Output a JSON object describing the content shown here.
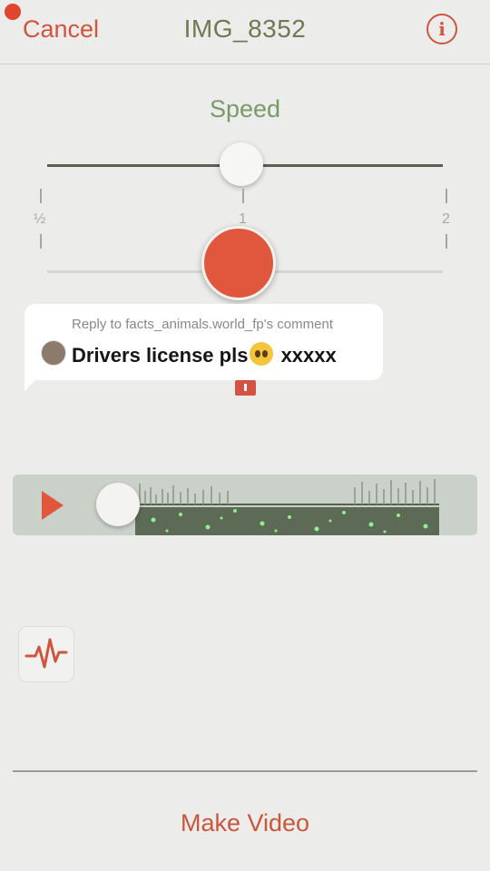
{
  "header": {
    "cancel_label": "Cancel",
    "title": "IMG_8352",
    "info_icon": "i"
  },
  "speed": {
    "label": "Speed",
    "ticks": [
      "½",
      "1",
      "2"
    ],
    "value": 1
  },
  "comment": {
    "reply_text": "Reply to facts_animals.world_fp's comment",
    "message": "Drivers license pls",
    "emoji": "pleading-face",
    "suffix": " xxxxx"
  },
  "player": {
    "play_icon": "play-icon"
  },
  "footer": {
    "make_video_label": "Make Video"
  },
  "colors": {
    "accent": "#e1573e",
    "background": "#ececea",
    "player_bg": "#c9d1c9"
  }
}
